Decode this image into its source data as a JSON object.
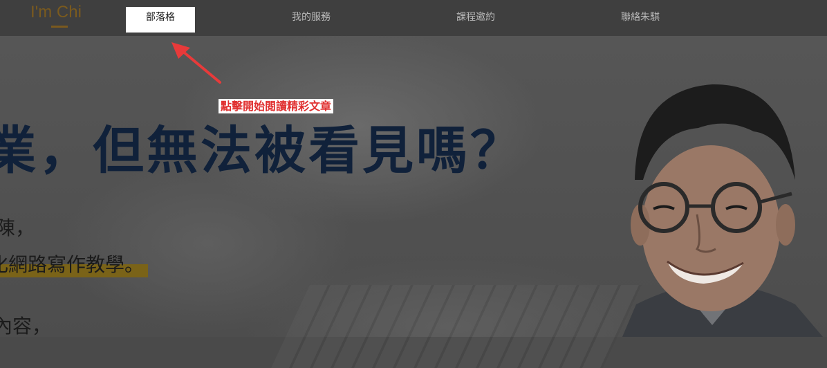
{
  "header": {
    "logo": "I'm Chi",
    "nav": [
      {
        "label": "部落格",
        "active": true
      },
      {
        "label": "我的服務"
      },
      {
        "label": "課程邀約"
      },
      {
        "label": "聯絡朱騏"
      }
    ]
  },
  "hero": {
    "headline": "業，但無法被看見嗎？",
    "line1": "陳，",
    "line2": "化網路寫作教學。",
    "line3": "內容，"
  },
  "annotation": {
    "text": "點擊開始閱讀精彩文章"
  },
  "colors": {
    "overlay": "#4a4a4a",
    "accent": "#7a5a1e",
    "headline": "#10213a",
    "annotation_text": "#e03030",
    "arrow": "#e83a3a"
  }
}
